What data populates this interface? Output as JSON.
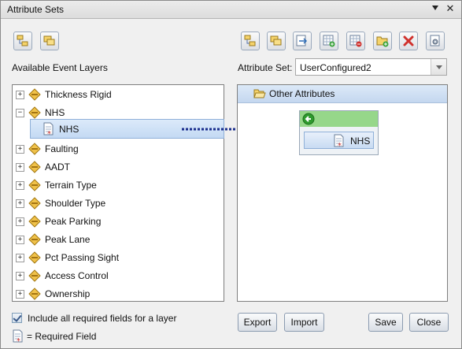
{
  "window": {
    "title": "Attribute Sets"
  },
  "labels": {
    "available_layers": "Available Event Layers",
    "attribute_set": "Attribute Set:",
    "include_required": "Include all required fields for a layer",
    "required_legend": "= Required Field"
  },
  "attribute_set_select": {
    "value": "UserConfigured2"
  },
  "left_toolbar": [
    {
      "icon": "sort-layers-icon"
    },
    {
      "icon": "copy-layers-icon"
    }
  ],
  "right_toolbar": [
    {
      "icon": "sort-set-icon"
    },
    {
      "icon": "copy-set-icon"
    },
    {
      "icon": "export-set-icon"
    },
    {
      "icon": "add-table-icon"
    },
    {
      "icon": "remove-table-icon"
    },
    {
      "icon": "new-folder-icon"
    },
    {
      "icon": "delete-icon"
    },
    {
      "icon": "properties-icon"
    }
  ],
  "tree": [
    {
      "label": "Thickness Rigid",
      "expanded": false
    },
    {
      "label": "NHS",
      "expanded": true,
      "children": [
        {
          "label": "NHS",
          "selected": true,
          "required": true
        }
      ]
    },
    {
      "label": "Faulting",
      "expanded": false
    },
    {
      "label": "AADT",
      "expanded": false
    },
    {
      "label": "Terrain Type",
      "expanded": false
    },
    {
      "label": "Shoulder Type",
      "expanded": false
    },
    {
      "label": "Peak Parking",
      "expanded": false
    },
    {
      "label": "Peak Lane",
      "expanded": false
    },
    {
      "label": "Pct Passing Sight",
      "expanded": false
    },
    {
      "label": "Access Control",
      "expanded": false
    },
    {
      "label": "Ownership",
      "expanded": false
    }
  ],
  "right_panel": {
    "header": "Other Attributes",
    "drop_item": "NHS"
  },
  "buttons": {
    "export": "Export",
    "import": "Import",
    "save": "Save",
    "close": "Close"
  },
  "colors": {
    "selection": "#c3d9f3",
    "drop_bar": "#96d78a",
    "arrow": "#1a2d8c"
  }
}
